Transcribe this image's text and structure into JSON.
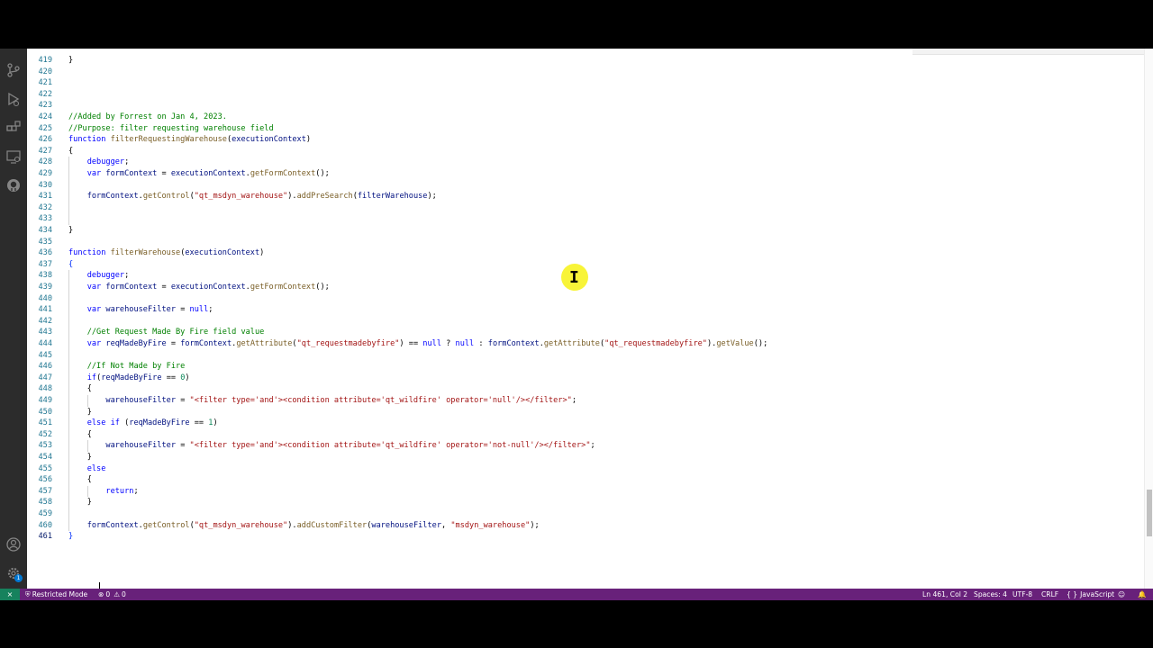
{
  "status_bar": {
    "restricted_mode": "Restricted Mode",
    "errors": "0",
    "warnings": "0",
    "position": "Ln 461, Col 2",
    "spaces": "Spaces: 4",
    "encoding": "UTF-8",
    "eol": "CRLF",
    "language": "JavaScript",
    "brace_icon": "{ }"
  },
  "activity_bar": {
    "items": [
      "source-control-icon",
      "run-debug-icon",
      "extensions-icon",
      "remote-explorer-icon",
      "github-icon"
    ],
    "bottom": [
      "account-icon",
      "manage-gear-icon"
    ],
    "badge": "1"
  },
  "editor": {
    "cursor": "Ln 461, Col 2",
    "lines": [
      {
        "n": "419",
        "t": [
          {
            "c": "t-punc",
            "s": "}"
          }
        ]
      },
      {
        "n": "420",
        "t": []
      },
      {
        "n": "421",
        "t": []
      },
      {
        "n": "422",
        "t": []
      },
      {
        "n": "423",
        "t": []
      },
      {
        "n": "424",
        "t": [
          {
            "c": "t-com",
            "s": "//Added by Forrest on Jan 4, 2023."
          }
        ]
      },
      {
        "n": "425",
        "t": [
          {
            "c": "t-com",
            "s": "//Purpose: filter requesting warehouse field"
          }
        ]
      },
      {
        "n": "426",
        "t": [
          {
            "c": "t-kw",
            "s": "function "
          },
          {
            "c": "t-fn",
            "s": "filterRequestingWarehouse"
          },
          {
            "c": "t-punc",
            "s": "("
          },
          {
            "c": "t-var",
            "s": "executionContext"
          },
          {
            "c": "t-punc",
            "s": ")"
          }
        ]
      },
      {
        "n": "427",
        "t": [
          {
            "c": "t-punc",
            "s": "{"
          }
        ]
      },
      {
        "n": "428",
        "t": [
          {
            "c": "t-punc",
            "s": "    "
          },
          {
            "c": "t-kw",
            "s": "debugger"
          },
          {
            "c": "t-punc",
            "s": ";"
          }
        ]
      },
      {
        "n": "429",
        "t": [
          {
            "c": "t-punc",
            "s": "    "
          },
          {
            "c": "t-kw",
            "s": "var "
          },
          {
            "c": "t-var",
            "s": "formContext"
          },
          {
            "c": "t-punc",
            "s": " = "
          },
          {
            "c": "t-var",
            "s": "executionContext"
          },
          {
            "c": "t-punc",
            "s": "."
          },
          {
            "c": "t-fn",
            "s": "getFormContext"
          },
          {
            "c": "t-punc",
            "s": "();"
          }
        ]
      },
      {
        "n": "430",
        "t": []
      },
      {
        "n": "431",
        "t": [
          {
            "c": "t-punc",
            "s": "    "
          },
          {
            "c": "t-var",
            "s": "formContext"
          },
          {
            "c": "t-punc",
            "s": "."
          },
          {
            "c": "t-fn",
            "s": "getControl"
          },
          {
            "c": "t-punc",
            "s": "("
          },
          {
            "c": "t-str",
            "s": "\"qt_msdyn_warehouse\""
          },
          {
            "c": "t-punc",
            "s": ")."
          },
          {
            "c": "t-fn",
            "s": "addPreSearch"
          },
          {
            "c": "t-punc",
            "s": "("
          },
          {
            "c": "t-var",
            "s": "filterWarehouse"
          },
          {
            "c": "t-punc",
            "s": ");"
          }
        ]
      },
      {
        "n": "432",
        "t": []
      },
      {
        "n": "433",
        "t": []
      },
      {
        "n": "434",
        "t": [
          {
            "c": "t-punc",
            "s": "}"
          }
        ]
      },
      {
        "n": "435",
        "t": []
      },
      {
        "n": "436",
        "t": [
          {
            "c": "t-kw",
            "s": "function "
          },
          {
            "c": "t-fn",
            "s": "filterWarehouse"
          },
          {
            "c": "t-punc",
            "s": "("
          },
          {
            "c": "t-var",
            "s": "executionContext"
          },
          {
            "c": "t-punc",
            "s": ")"
          }
        ]
      },
      {
        "n": "437",
        "t": [
          {
            "c": "t-bracket",
            "s": "{"
          }
        ]
      },
      {
        "n": "438",
        "t": [
          {
            "c": "t-punc",
            "s": "    "
          },
          {
            "c": "t-kw",
            "s": "debugger"
          },
          {
            "c": "t-punc",
            "s": ";"
          }
        ]
      },
      {
        "n": "439",
        "t": [
          {
            "c": "t-punc",
            "s": "    "
          },
          {
            "c": "t-kw",
            "s": "var "
          },
          {
            "c": "t-var",
            "s": "formContext"
          },
          {
            "c": "t-punc",
            "s": " = "
          },
          {
            "c": "t-var",
            "s": "executionContext"
          },
          {
            "c": "t-punc",
            "s": "."
          },
          {
            "c": "t-fn",
            "s": "getFormContext"
          },
          {
            "c": "t-punc",
            "s": "();"
          }
        ]
      },
      {
        "n": "440",
        "t": []
      },
      {
        "n": "441",
        "t": [
          {
            "c": "t-punc",
            "s": "    "
          },
          {
            "c": "t-kw",
            "s": "var "
          },
          {
            "c": "t-var",
            "s": "warehouseFilter"
          },
          {
            "c": "t-punc",
            "s": " = "
          },
          {
            "c": "t-kw",
            "s": "null"
          },
          {
            "c": "t-punc",
            "s": ";"
          }
        ]
      },
      {
        "n": "442",
        "t": []
      },
      {
        "n": "443",
        "t": [
          {
            "c": "t-punc",
            "s": "    "
          },
          {
            "c": "t-com",
            "s": "//Get Request Made By Fire field value"
          }
        ]
      },
      {
        "n": "444",
        "t": [
          {
            "c": "t-punc",
            "s": "    "
          },
          {
            "c": "t-kw",
            "s": "var "
          },
          {
            "c": "t-var",
            "s": "reqMadeByFire"
          },
          {
            "c": "t-punc",
            "s": " = "
          },
          {
            "c": "t-var",
            "s": "formContext"
          },
          {
            "c": "t-punc",
            "s": "."
          },
          {
            "c": "t-fn",
            "s": "getAttribute"
          },
          {
            "c": "t-punc",
            "s": "("
          },
          {
            "c": "t-str",
            "s": "\"qt_requestmadebyfire\""
          },
          {
            "c": "t-punc",
            "s": ") == "
          },
          {
            "c": "t-kw",
            "s": "null"
          },
          {
            "c": "t-punc",
            "s": " ? "
          },
          {
            "c": "t-kw",
            "s": "null"
          },
          {
            "c": "t-punc",
            "s": " : "
          },
          {
            "c": "t-var",
            "s": "formContext"
          },
          {
            "c": "t-punc",
            "s": "."
          },
          {
            "c": "t-fn",
            "s": "getAttribute"
          },
          {
            "c": "t-punc",
            "s": "("
          },
          {
            "c": "t-str",
            "s": "\"qt_requestmadebyfire\""
          },
          {
            "c": "t-punc",
            "s": ")."
          },
          {
            "c": "t-fn",
            "s": "getValue"
          },
          {
            "c": "t-punc",
            "s": "();"
          }
        ]
      },
      {
        "n": "445",
        "t": []
      },
      {
        "n": "446",
        "t": [
          {
            "c": "t-punc",
            "s": "    "
          },
          {
            "c": "t-com",
            "s": "//If Not Made by Fire"
          }
        ]
      },
      {
        "n": "447",
        "t": [
          {
            "c": "t-punc",
            "s": "    "
          },
          {
            "c": "t-kw",
            "s": "if"
          },
          {
            "c": "t-punc",
            "s": "("
          },
          {
            "c": "t-var",
            "s": "reqMadeByFire"
          },
          {
            "c": "t-punc",
            "s": " == "
          },
          {
            "c": "t-num",
            "s": "0"
          },
          {
            "c": "t-punc",
            "s": ")"
          }
        ]
      },
      {
        "n": "448",
        "t": [
          {
            "c": "t-punc",
            "s": "    {"
          }
        ]
      },
      {
        "n": "449",
        "t": [
          {
            "c": "t-punc",
            "s": "        "
          },
          {
            "c": "t-var",
            "s": "warehouseFilter"
          },
          {
            "c": "t-punc",
            "s": " = "
          },
          {
            "c": "t-str",
            "s": "\"<filter type='and'><condition attribute='qt_wildfire' operator='null'/></filter>\""
          },
          {
            "c": "t-punc",
            "s": ";"
          }
        ]
      },
      {
        "n": "450",
        "t": [
          {
            "c": "t-punc",
            "s": "    }"
          }
        ]
      },
      {
        "n": "451",
        "t": [
          {
            "c": "t-punc",
            "s": "    "
          },
          {
            "c": "t-kw",
            "s": "else if"
          },
          {
            "c": "t-punc",
            "s": " ("
          },
          {
            "c": "t-var",
            "s": "reqMadeByFire"
          },
          {
            "c": "t-punc",
            "s": " == "
          },
          {
            "c": "t-num",
            "s": "1"
          },
          {
            "c": "t-punc",
            "s": ")"
          }
        ]
      },
      {
        "n": "452",
        "t": [
          {
            "c": "t-punc",
            "s": "    {"
          }
        ]
      },
      {
        "n": "453",
        "t": [
          {
            "c": "t-punc",
            "s": "        "
          },
          {
            "c": "t-var",
            "s": "warehouseFilter"
          },
          {
            "c": "t-punc",
            "s": " = "
          },
          {
            "c": "t-str",
            "s": "\"<filter type='and'><condition attribute='qt_wildfire' operator='not-null'/></filter>\""
          },
          {
            "c": "t-punc",
            "s": ";"
          }
        ]
      },
      {
        "n": "454",
        "t": [
          {
            "c": "t-punc",
            "s": "    }"
          }
        ]
      },
      {
        "n": "455",
        "t": [
          {
            "c": "t-punc",
            "s": "    "
          },
          {
            "c": "t-kw",
            "s": "else"
          }
        ]
      },
      {
        "n": "456",
        "t": [
          {
            "c": "t-punc",
            "s": "    {"
          }
        ]
      },
      {
        "n": "457",
        "t": [
          {
            "c": "t-punc",
            "s": "        "
          },
          {
            "c": "t-kw",
            "s": "return"
          },
          {
            "c": "t-punc",
            "s": ";"
          }
        ]
      },
      {
        "n": "458",
        "t": [
          {
            "c": "t-punc",
            "s": "    }"
          }
        ]
      },
      {
        "n": "459",
        "t": []
      },
      {
        "n": "460",
        "t": [
          {
            "c": "t-punc",
            "s": "    "
          },
          {
            "c": "t-var",
            "s": "formContext"
          },
          {
            "c": "t-punc",
            "s": "."
          },
          {
            "c": "t-fn",
            "s": "getControl"
          },
          {
            "c": "t-punc",
            "s": "("
          },
          {
            "c": "t-str",
            "s": "\"qt_msdyn_warehouse\""
          },
          {
            "c": "t-punc",
            "s": ")."
          },
          {
            "c": "t-fn",
            "s": "addCustomFilter"
          },
          {
            "c": "t-punc",
            "s": "("
          },
          {
            "c": "t-var",
            "s": "warehouseFilter"
          },
          {
            "c": "t-punc",
            "s": ", "
          },
          {
            "c": "t-str",
            "s": "\"msdyn_warehouse\""
          },
          {
            "c": "t-punc",
            "s": ");"
          }
        ]
      },
      {
        "n": "461",
        "t": [
          {
            "c": "t-bracket",
            "s": "}"
          }
        ]
      }
    ]
  }
}
